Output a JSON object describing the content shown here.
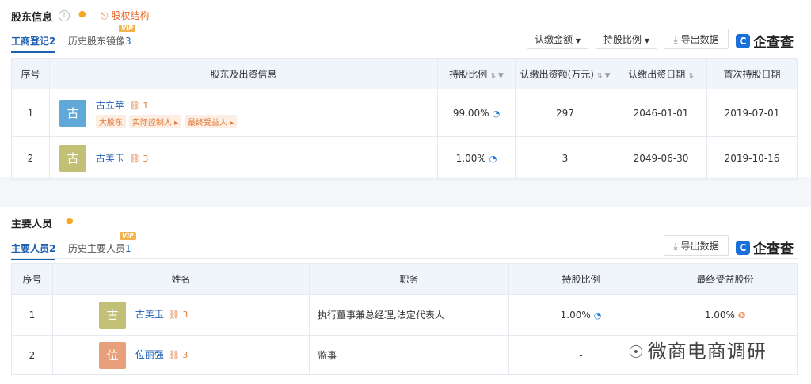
{
  "shareholders": {
    "title": "股东信息",
    "structure_link": "股权结构",
    "tabs": [
      {
        "label": "工商登记",
        "count": "2"
      },
      {
        "label": "历史股东镜像",
        "count": "3",
        "badge": "VIP"
      }
    ],
    "buttons": {
      "subscribed": "认缴金额",
      "ratio": "持股比例",
      "export": "导出数据"
    },
    "logo": "企查查",
    "columns": [
      "序号",
      "股东及出资信息",
      "持股比例",
      "认缴出资额(万元)",
      "认缴出资日期",
      "首次持股日期"
    ],
    "rows": [
      {
        "no": "1",
        "avatar": "古",
        "avatar_color": "#5fa8d8",
        "name": "古立苹",
        "relations": "1",
        "tags": [
          "大股东",
          "实际控制人",
          "最终受益人"
        ],
        "ratio": "99.00%",
        "amount": "297",
        "sub_date": "2046-01-01",
        "first_date": "2019-07-01"
      },
      {
        "no": "2",
        "avatar": "古",
        "avatar_color": "#c2bf76",
        "name": "古美玉",
        "relations": "3",
        "tags": [],
        "ratio": "1.00%",
        "amount": "3",
        "sub_date": "2049-06-30",
        "first_date": "2019-10-16"
      }
    ]
  },
  "personnel": {
    "title": "主要人员",
    "tabs": [
      {
        "label": "主要人员",
        "count": "2"
      },
      {
        "label": "历史主要人员",
        "count": "1",
        "badge": "VIP"
      }
    ],
    "buttons": {
      "export": "导出数据"
    },
    "logo": "企查查",
    "columns": [
      "序号",
      "姓名",
      "职务",
      "持股比例",
      "最终受益股份"
    ],
    "rows": [
      {
        "no": "1",
        "avatar": "古",
        "avatar_color": "#c2bf76",
        "name": "古美玉",
        "relations": "3",
        "position": "执行董事兼总经理,法定代表人",
        "ratio": "1.00%",
        "benefit": "1.00%"
      },
      {
        "no": "2",
        "avatar": "位",
        "avatar_color": "#e8a07c",
        "name": "位丽强",
        "relations": "3",
        "position": "监事",
        "ratio": "-",
        "benefit": ""
      }
    ]
  },
  "watermark": "微商电商调研",
  "icons": {
    "info": "info-icon",
    "bell": "bell-icon",
    "structure": "org-chart-icon",
    "export": "download-icon",
    "pie": "pie-chart-icon",
    "relation": "relation-icon",
    "ring": "ring-icon",
    "wechat": "wechat-icon"
  }
}
